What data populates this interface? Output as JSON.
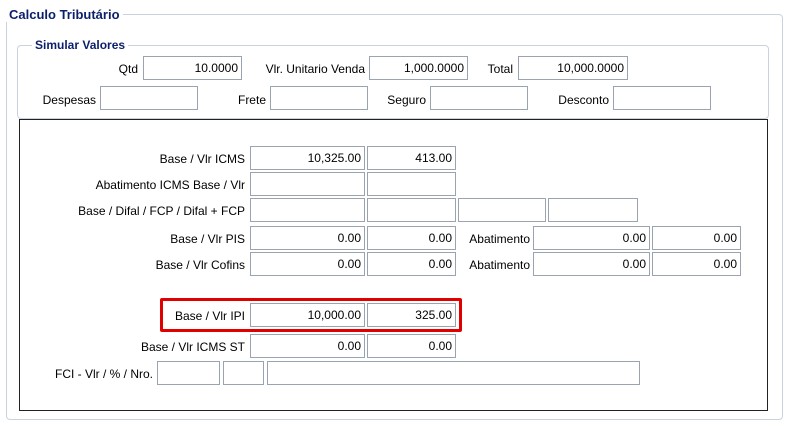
{
  "calculo": {
    "legend": "Calculo Tributário"
  },
  "simular": {
    "legend": "Simular Valores",
    "qtd_label": "Qtd",
    "qtd_value": "10.0000",
    "vlr_unit_label": "Vlr. Unitario Venda",
    "vlr_unit_value": "1,000.0000",
    "total_label": "Total",
    "total_value": "10,000.0000",
    "despesas_label": "Despesas",
    "despesas_value": "",
    "frete_label": "Frete",
    "frete_value": "",
    "seguro_label": "Seguro",
    "seguro_value": "",
    "desconto_label": "Desconto",
    "desconto_value": ""
  },
  "tributos": {
    "icms_label": "Base / Vlr ICMS",
    "icms_base": "10,325.00",
    "icms_vlr": "413.00",
    "abat_icms_label": "Abatimento ICMS Base  / Vlr",
    "abat_icms_base": "",
    "abat_icms_vlr": "",
    "difal_label": "Base / Difal / FCP / Difal + FCP",
    "difal_base": "",
    "difal_difal": "",
    "difal_fcp": "",
    "difal_total": "",
    "pis_label": "Base / Vlr PIS",
    "pis_base": "0.00",
    "pis_vlr": "0.00",
    "pis_abat_label": "Abatimento",
    "pis_abat_1": "0.00",
    "pis_abat_2": "0.00",
    "cofins_label": "Base / Vlr Cofins",
    "cofins_base": "0.00",
    "cofins_vlr": "0.00",
    "cofins_abat_label": "Abatimento",
    "cofins_abat_1": "0.00",
    "cofins_abat_2": "0.00",
    "ipi_label": "Base / Vlr IPI",
    "ipi_base": "10,000.00",
    "ipi_vlr": "325.00",
    "icms_st_label": "Base / Vlr ICMS ST",
    "icms_st_base": "0.00",
    "icms_st_vlr": "0.00",
    "fci_label": "FCI - Vlr / % / Nro.",
    "fci_vlr": "",
    "fci_pct": "",
    "fci_nro": ""
  },
  "colors": {
    "legend": "#0b1f6b",
    "highlight": "#e00000",
    "border": "#c9d3df"
  }
}
